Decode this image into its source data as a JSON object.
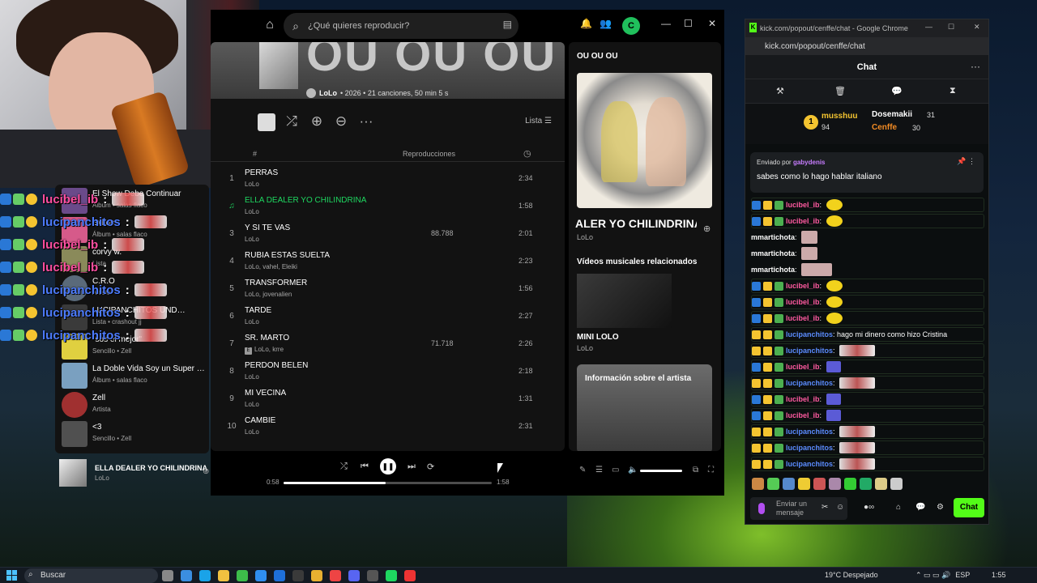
{
  "webcam": {},
  "overlay_chat": [
    {
      "name": "El Show Debe Continuar",
      "color": "#ffffff",
      "type": "title"
    },
    {
      "name": "lucibel_ib",
      "color": "#ff4fa0"
    },
    {
      "name": "lucipanchitos",
      "color": "#4d7cff"
    },
    {
      "name": "lucibel_ib",
      "color": "#ff4fa0"
    },
    {
      "name": "lucibel_ib",
      "color": "#ff4fa0"
    },
    {
      "name": "lucipanchitos",
      "color": "#4d7cff"
    },
    {
      "name": "lucipanchitos",
      "color": "#4d7cff"
    },
    {
      "name": "lucipanchitos",
      "color": "#4d7cff"
    }
  ],
  "library": {
    "items": [
      {
        "name": "El Show Debe Continuar",
        "sub": "Álbum • salas flaco",
        "color": "#6a4a8a",
        "round": false
      },
      {
        "name": "Exitos",
        "sub": "Álbum • salas flaco",
        "color": "#d65a8a",
        "round": false
      },
      {
        "name": "corvy w.",
        "sub": "Lista",
        "color": "#8a8a5a",
        "round": false
      },
      {
        "name": "C.R.O",
        "sub": "Artista",
        "color": "#5a6a7a",
        "round": true
      },
      {
        "name": "LUCIPANCHITOS UND…",
        "sub": "Lista • crashout jj",
        "color": "#3a3a3a",
        "round": false
      },
      {
        "name": "\"sos el mejor\"",
        "sub": "Sencillo • Zell",
        "color": "#e0d040",
        "round": false
      },
      {
        "name": "La Doble Vida Soy un Super …",
        "sub": "Álbum • salas flaco",
        "color": "#7aa0c0",
        "round": false
      },
      {
        "name": "Zell",
        "sub": "Artista",
        "color": "#a03030",
        "round": true
      },
      {
        "name": "<3",
        "sub": "Sencillo • Zell",
        "color": "#505050",
        "round": false
      }
    ]
  },
  "spotify": {
    "search_placeholder": "¿Qué quieres reproducir?",
    "album_title": "OU OU OU",
    "artist": "LoLo",
    "meta": "• 2026 • 21 canciones, 50 min 5 s",
    "view_label": "Lista",
    "col_plays": "Reproducciones",
    "col_hash": "#",
    "tracks": [
      {
        "num": "1",
        "title": "PERRAS",
        "artist": "LoLo",
        "plays": "",
        "duration": "2:34",
        "explicit": false
      },
      {
        "num": "♫",
        "title": "ELLA DEALER YO CHILINDRINA",
        "artist": "LoLo",
        "plays": "",
        "duration": "1:58",
        "explicit": false,
        "active": true
      },
      {
        "num": "3",
        "title": "Y SI TE VAS",
        "artist": "LoLo",
        "plays": "88.788",
        "duration": "2:01",
        "explicit": false
      },
      {
        "num": "4",
        "title": "RUBIA ESTAS SUELTA",
        "artist": "LoLo, vahel, Eleiki",
        "plays": "",
        "duration": "2:23",
        "explicit": false
      },
      {
        "num": "5",
        "title": "TRANSFORMER",
        "artist": "LoLo, jovenalien",
        "plays": "",
        "duration": "1:56",
        "explicit": false
      },
      {
        "num": "6",
        "title": "TARDE",
        "artist": "LoLo",
        "plays": "",
        "duration": "2:27",
        "explicit": false
      },
      {
        "num": "7",
        "title": "SR. MARTO",
        "artist": "LoLo, krre",
        "plays": "71.718",
        "duration": "2:26",
        "explicit": true
      },
      {
        "num": "8",
        "title": "PERDON BELEN",
        "artist": "LoLo",
        "plays": "",
        "duration": "2:18",
        "explicit": false
      },
      {
        "num": "9",
        "title": "MI VECINA",
        "artist": "LoLo",
        "plays": "",
        "duration": "1:31",
        "explicit": false
      },
      {
        "num": "10",
        "title": "CAMBIE",
        "artist": "LoLo",
        "plays": "",
        "duration": "2:31",
        "explicit": false
      }
    ],
    "right_panel": {
      "title": "OU OU OU",
      "song": "ELLA DEALER YO CHILINDRINA",
      "song_visible": "ALER YO CHILINDRINA",
      "artist": "LoLo",
      "videos_heading": "Vídeos musicales relacionados",
      "video_title": "MINI LOLO",
      "video_artist": "LoLo",
      "artist_info": "Información sobre el artista"
    },
    "player": {
      "title": "ELLA DEALER YO CHILINDRINA",
      "artist": "LoLo",
      "elapsed": "0:58",
      "total": "1:58",
      "progress": 0.49
    }
  },
  "chrome": {
    "window_title": "kick.com/popout/cenffe/chat - Google Chrome",
    "url": "kick.com/popout/cenffe/chat",
    "chat_title": "Chat",
    "top_gifters": [
      {
        "name": "musshuu",
        "count": "94"
      },
      {
        "name": "Dosemakii",
        "count": "31"
      },
      {
        "name": "Cenffe",
        "count": "30"
      }
    ],
    "rank": "1",
    "pinned_label": "Enviado por",
    "pinned_by": "gabydenis",
    "pinned_message": "sabes como lo hago hablar italiano",
    "messages": [
      {
        "name": "lucibel_ib",
        "color": "#ff5aa0",
        "text": "",
        "emote": "yellow",
        "badges": [
          "#2a78d6",
          "#f4c430",
          "#4caf50"
        ]
      },
      {
        "name": "lucibel_ib",
        "color": "#ff5aa0",
        "text": "",
        "emote": "yellow",
        "badges": [
          "#2a78d6",
          "#f4c430",
          "#4caf50"
        ]
      },
      {
        "name": "mmartichota",
        "color": "#ffffff",
        "text": "",
        "emote": "sq",
        "badges": []
      },
      {
        "name": "mmartichota",
        "color": "#ffffff",
        "text": "",
        "emote": "sq",
        "badges": []
      },
      {
        "name": "mmartichota",
        "color": "#ffffff",
        "text": "",
        "emote": "sq2",
        "badges": []
      },
      {
        "name": "lucibel_ib",
        "color": "#ff5aa0",
        "text": "",
        "emote": "yellow",
        "badges": [
          "#2a78d6",
          "#f4c430",
          "#4caf50"
        ]
      },
      {
        "name": "lucibel_ib",
        "color": "#ff5aa0",
        "text": "",
        "emote": "yellow",
        "badges": [
          "#2a78d6",
          "#f4c430",
          "#4caf50"
        ]
      },
      {
        "name": "lucibel_ib",
        "color": "#ff5aa0",
        "text": "",
        "emote": "yellow",
        "badges": [
          "#2a78d6",
          "#f4c430",
          "#4caf50"
        ]
      },
      {
        "name": "lucipanchitos",
        "color": "#5b8cff",
        "text": "hago mi dinero como hizo Cristina",
        "emote": "",
        "badges": [
          "#f4c430",
          "#f4c430",
          "#4caf50"
        ]
      },
      {
        "name": "lucipanchitos",
        "color": "#5b8cff",
        "text": "",
        "emote": "wide",
        "badges": [
          "#f4c430",
          "#f4c430",
          "#4caf50"
        ]
      },
      {
        "name": "lucibel_ib",
        "color": "#ff5aa0",
        "text": "",
        "emote": "blue",
        "badges": [
          "#2a78d6",
          "#f4c430",
          "#4caf50"
        ]
      },
      {
        "name": "lucipanchitos",
        "color": "#5b8cff",
        "text": "",
        "emote": "wide",
        "badges": [
          "#f4c430",
          "#f4c430",
          "#4caf50"
        ]
      },
      {
        "name": "lucibel_ib",
        "color": "#ff5aa0",
        "text": "",
        "emote": "blue",
        "badges": [
          "#2a78d6",
          "#f4c430",
          "#4caf50"
        ]
      },
      {
        "name": "lucibel_ib",
        "color": "#ff5aa0",
        "text": "",
        "emote": "blue",
        "badges": [
          "#2a78d6",
          "#f4c430",
          "#4caf50"
        ]
      },
      {
        "name": "lucipanchitos",
        "color": "#5b8cff",
        "text": "",
        "emote": "wide",
        "badges": [
          "#f4c430",
          "#f4c430",
          "#4caf50"
        ]
      },
      {
        "name": "lucipanchitos",
        "color": "#5b8cff",
        "text": "",
        "emote": "wide",
        "badges": [
          "#f4c430",
          "#f4c430",
          "#4caf50"
        ]
      },
      {
        "name": "lucipanchitos",
        "color": "#5b8cff",
        "text": "",
        "emote": "wide",
        "badges": [
          "#f4c430",
          "#f4c430",
          "#4caf50"
        ]
      }
    ],
    "input_placeholder": "Enviar un mensaje",
    "send_label": "Chat"
  },
  "taskbar": {
    "search_label": "Buscar",
    "weather": "19°C  Despejado",
    "lang": "ESP",
    "time": "1:55"
  },
  "colors": {
    "spotify_green": "#1ed760",
    "kick_green": "#53fc18"
  }
}
